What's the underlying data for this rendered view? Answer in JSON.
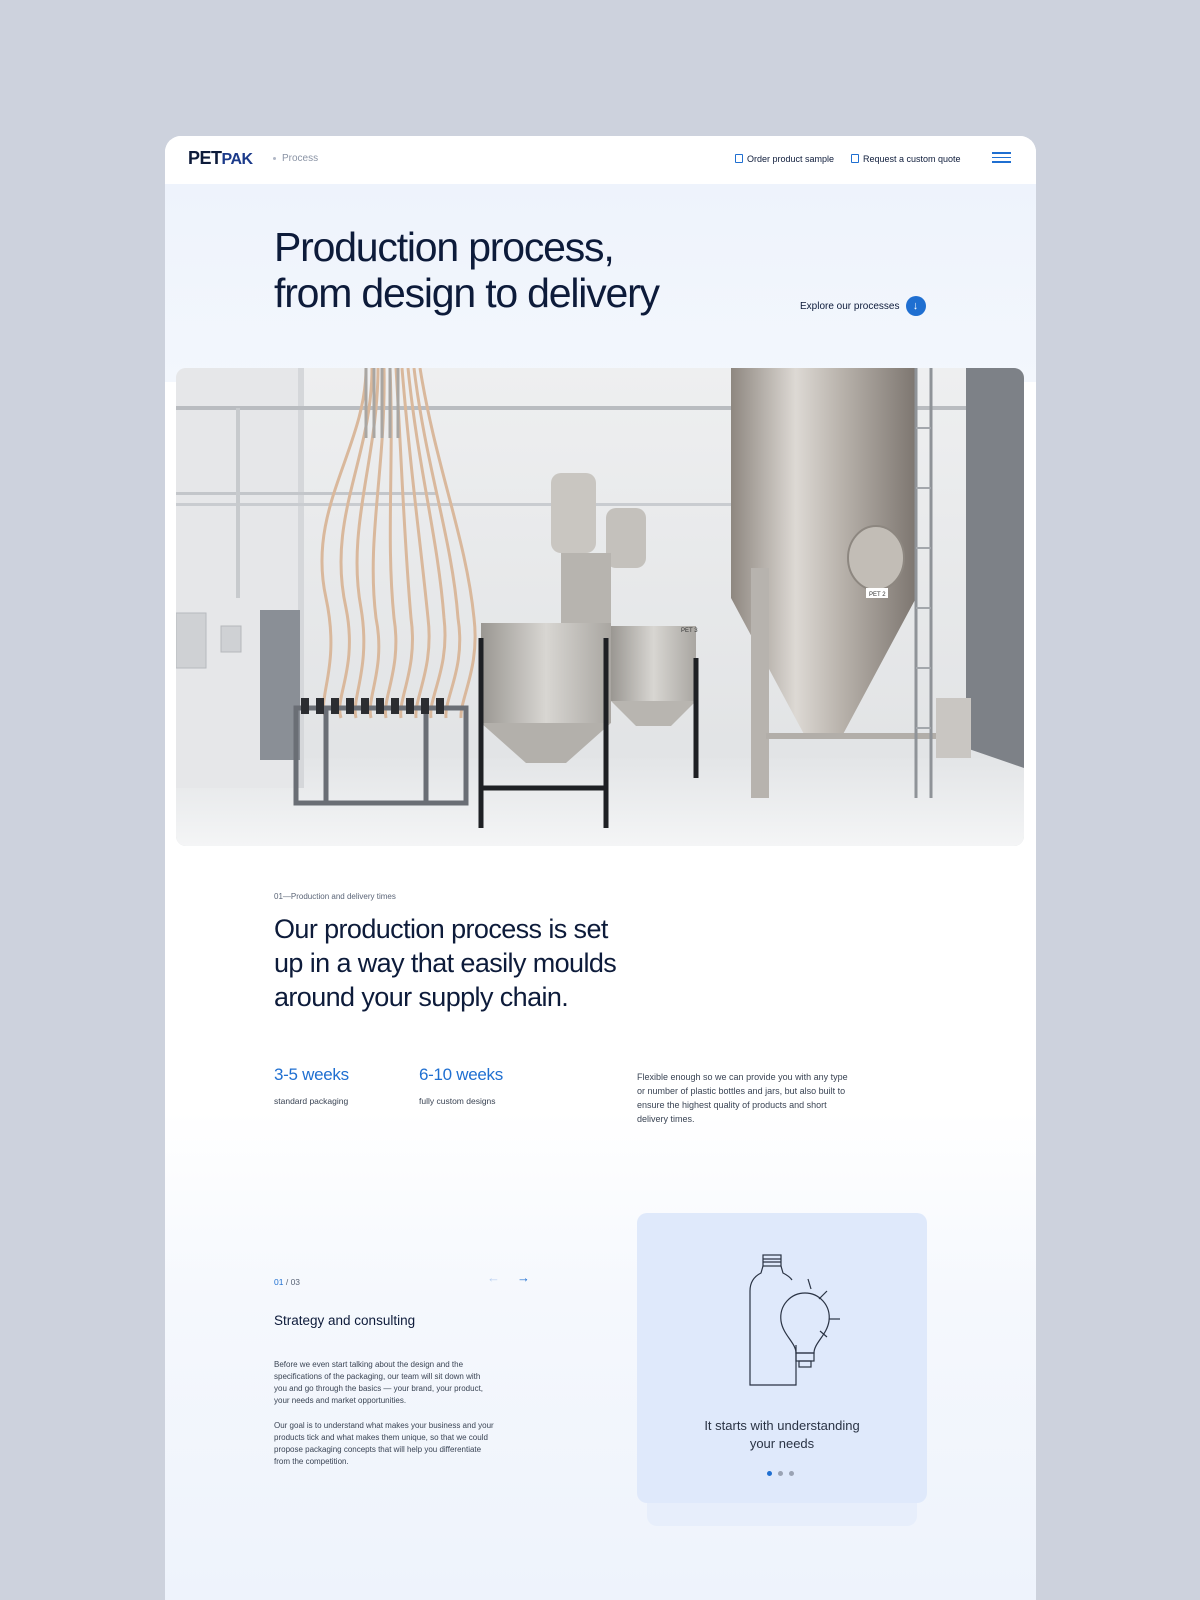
{
  "header": {
    "logo_pet": "PET",
    "logo_pak": "PAK",
    "breadcrumb": "Process",
    "order_sample": "Order product sample",
    "request_quote": "Request a custom quote"
  },
  "hero": {
    "title_line1": "Production process,",
    "title_line2": "from design to delivery",
    "explore_label": "Explore our processes"
  },
  "section1": {
    "eyebrow": "01—Production and delivery times",
    "lead_line1": "Our production process is set",
    "lead_line2": "up in a way that easily moulds",
    "lead_line3": "around your supply chain.",
    "stats": [
      {
        "value": "3-5 weeks",
        "label": "standard packaging"
      },
      {
        "value": "6-10 weeks",
        "label": "fully custom designs"
      }
    ],
    "description": "Flexible enough so we can provide you with any type or number of plastic bottles and jars, but also built to ensure the highest quality of products and short delivery times."
  },
  "slider": {
    "current": "01",
    "total": "/ 03",
    "title": "Strategy and consulting",
    "paragraph1": "Before we even start talking about the design and the specifications of the packaging, our team will sit down with you and go through the basics — your brand, your product, your needs and market opportunities.",
    "paragraph2": "Our goal is to understand what makes your business and your products tick and what makes them unique, so that we could propose packaging concepts that will help you differentiate from the competition.",
    "panel_caption_line1": "It starts with understanding",
    "panel_caption_line2": "your needs",
    "active_dot": 1,
    "dot_count": 3
  },
  "photo": {
    "tank_label_1": "PET 2",
    "tank_label_2": "PET 3"
  },
  "colors": {
    "accent": "#1f6fd1",
    "navy": "#0d1b3a",
    "background": "#cdd2dd",
    "panel": "#dfe9fb"
  }
}
